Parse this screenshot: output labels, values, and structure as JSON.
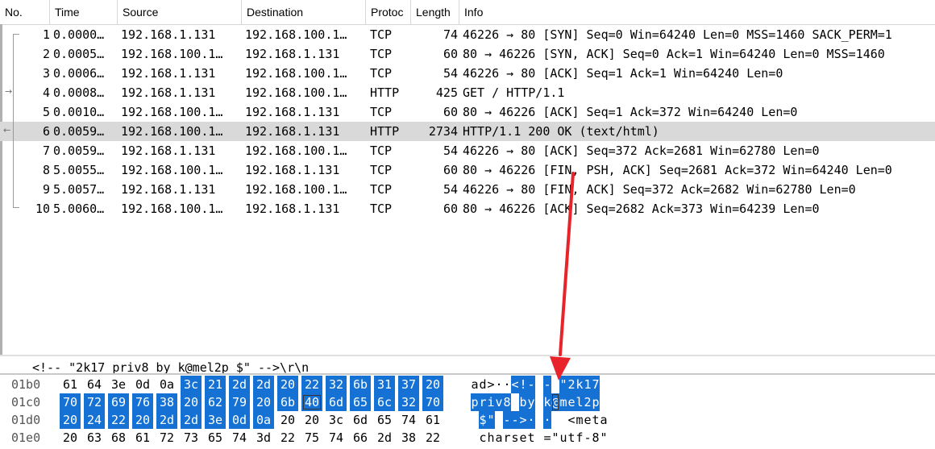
{
  "columns": {
    "no": "No.",
    "time": "Time",
    "source": "Source",
    "destination": "Destination",
    "protocol": "Protoc",
    "length": "Length",
    "info": "Info"
  },
  "packets": [
    {
      "no": "1",
      "time": "0.0000…",
      "src": "192.168.1.131",
      "dst": "192.168.100.1…",
      "proto": "TCP",
      "len": "74",
      "info": "46226 → 80 [SYN] Seq=0 Win=64240 Len=0 MSS=1460 SACK_PERM=1"
    },
    {
      "no": "2",
      "time": "0.0005…",
      "src": "192.168.100.1…",
      "dst": "192.168.1.131",
      "proto": "TCP",
      "len": "60",
      "info": "80 → 46226 [SYN, ACK] Seq=0 Ack=1 Win=64240 Len=0 MSS=1460"
    },
    {
      "no": "3",
      "time": "0.0006…",
      "src": "192.168.1.131",
      "dst": "192.168.100.1…",
      "proto": "TCP",
      "len": "54",
      "info": "46226 → 80 [ACK] Seq=1 Ack=1 Win=64240 Len=0"
    },
    {
      "no": "4",
      "time": "0.0008…",
      "src": "192.168.1.131",
      "dst": "192.168.100.1…",
      "proto": "HTTP",
      "len": "425",
      "info": "GET / HTTP/1.1"
    },
    {
      "no": "5",
      "time": "0.0010…",
      "src": "192.168.100.1…",
      "dst": "192.168.1.131",
      "proto": "TCP",
      "len": "60",
      "info": "80 → 46226 [ACK] Seq=1 Ack=372 Win=64240 Len=0"
    },
    {
      "no": "6",
      "time": "0.0059…",
      "src": "192.168.100.1…",
      "dst": "192.168.1.131",
      "proto": "HTTP",
      "len": "2734",
      "info": "HTTP/1.1 200 OK  (text/html)"
    },
    {
      "no": "7",
      "time": "0.0059…",
      "src": "192.168.1.131",
      "dst": "192.168.100.1…",
      "proto": "TCP",
      "len": "54",
      "info": "46226 → 80 [ACK] Seq=372 Ack=2681 Win=62780 Len=0"
    },
    {
      "no": "8",
      "time": "5.0055…",
      "src": "192.168.100.1…",
      "dst": "192.168.1.131",
      "proto": "TCP",
      "len": "60",
      "info": "80 → 46226 [FIN, PSH, ACK] Seq=2681 Ack=372 Win=64240 Len=0"
    },
    {
      "no": "9",
      "time": "5.0057…",
      "src": "192.168.1.131",
      "dst": "192.168.100.1…",
      "proto": "TCP",
      "len": "54",
      "info": "46226 → 80 [FIN, ACK] Seq=372 Ack=2682 Win=62780 Len=0"
    },
    {
      "no": "10",
      "time": "5.0060…",
      "src": "192.168.100.1…",
      "dst": "192.168.1.131",
      "proto": "TCP",
      "len": "60",
      "info": "80 → 46226 [ACK] Seq=2682 Ack=373 Win=64239 Len=0"
    }
  ],
  "selected_packet": "6",
  "detail_truncated": "<!-- \"2k17 priv8 by k@mel2p $\" -->\\r\\n",
  "hex_rows": [
    {
      "offset": "01b0",
      "bytes": [
        "61",
        "64",
        "3e",
        "0d",
        "0a",
        "3c",
        "21",
        "2d",
        "2d",
        "20",
        "22",
        "32",
        "6b",
        "31",
        "37",
        "20"
      ],
      "ascii": [
        "a",
        "d",
        ">",
        "·",
        "·",
        "<",
        "!",
        "-",
        " ",
        "-",
        " ",
        "\"",
        "2",
        "k",
        "1",
        "7"
      ]
    },
    {
      "offset": "01c0",
      "bytes": [
        "70",
        "72",
        "69",
        "76",
        "38",
        "20",
        "62",
        "79",
        "20",
        "6b",
        "40",
        "6d",
        "65",
        "6c",
        "32",
        "70"
      ],
      "ascii": [
        "p",
        "r",
        "i",
        "v",
        "8",
        " ",
        "b",
        "y",
        " ",
        "k",
        "@",
        "m",
        "e",
        "l",
        "2",
        "p"
      ]
    },
    {
      "offset": "01d0",
      "bytes": [
        "20",
        "24",
        "22",
        "20",
        "2d",
        "2d",
        "3e",
        "0d",
        "0a",
        "20",
        "20",
        "3c",
        "6d",
        "65",
        "74",
        "61"
      ],
      "ascii": [
        " ",
        "$",
        "\"",
        " ",
        "-",
        "-",
        ">",
        "·",
        " ",
        "·",
        " ",
        " ",
        "<",
        "m",
        "e",
        "t",
        "a"
      ]
    },
    {
      "offset": "01e0",
      "bytes": [
        "20",
        "63",
        "68",
        "61",
        "72",
        "73",
        "65",
        "74",
        "3d",
        "22",
        "75",
        "74",
        "66",
        "2d",
        "38",
        "22"
      ],
      "ascii": [
        " ",
        "c",
        "h",
        "a",
        "r",
        "s",
        "e",
        "t",
        " ",
        "=",
        "\"",
        "u",
        "t",
        "f",
        "-",
        "8",
        "\""
      ]
    }
  ],
  "colors": {
    "selection_blue": "#1572d4",
    "selected_row": "#d9d9d9",
    "annotation_red": "#e8242a"
  }
}
